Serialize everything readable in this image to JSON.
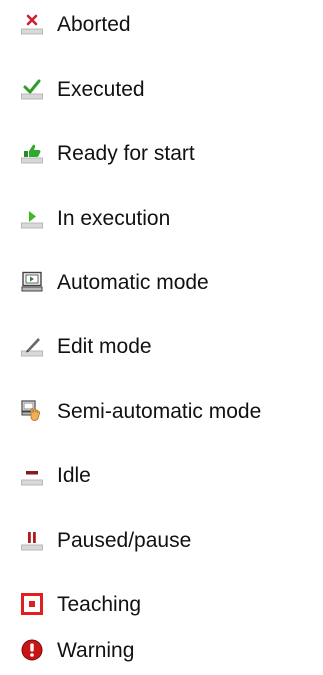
{
  "legend": {
    "items": [
      {
        "key": "aborted",
        "label": "Aborted",
        "icon": "x-mark-icon",
        "color": "#cc1f2f"
      },
      {
        "key": "executed",
        "label": "Executed",
        "icon": "checkmark-icon",
        "color": "#2e9e2e"
      },
      {
        "key": "ready",
        "label": "Ready for start",
        "icon": "thumbs-up-icon",
        "color": "#2faa2f"
      },
      {
        "key": "in_execution",
        "label": "In execution",
        "icon": "play-icon",
        "color": "#44b824"
      },
      {
        "key": "automatic",
        "label": "Automatic mode",
        "icon": "computer-monitor-icon",
        "color": "#3c7a3c"
      },
      {
        "key": "edit",
        "label": "Edit mode",
        "icon": "pencil-icon",
        "color": "#555555"
      },
      {
        "key": "semi_automatic",
        "label": "Semi-automatic mode",
        "icon": "hand-on-computer-icon",
        "color": "#f0b05a"
      },
      {
        "key": "idle",
        "label": "Idle",
        "icon": "minus-bar-icon",
        "color": "#8b1a1a"
      },
      {
        "key": "paused",
        "label": "Paused/pause",
        "icon": "pause-icon",
        "color": "#b01c1c"
      },
      {
        "key": "teaching",
        "label": "Teaching",
        "icon": "target-box-icon",
        "color": "#e02020"
      },
      {
        "key": "warning",
        "label": "Warning",
        "icon": "exclamation-circle-icon",
        "color": "#c81414"
      }
    ]
  }
}
